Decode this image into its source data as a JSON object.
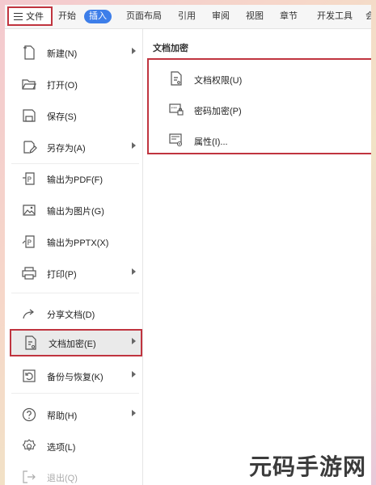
{
  "tabbar": {
    "file_label": "文件",
    "tabs": [
      "开始",
      "插入",
      "页面布局",
      "引用",
      "审阅",
      "视图",
      "章节",
      "开发工具",
      "会"
    ],
    "active_tab": "插入"
  },
  "menu": {
    "items": [
      {
        "label": "新建(N)",
        "icon": "new-document-icon",
        "has_submenu": true
      },
      {
        "label": "打开(O)",
        "icon": "folder-open-icon",
        "has_submenu": false
      },
      {
        "label": "保存(S)",
        "icon": "save-icon",
        "has_submenu": false
      },
      {
        "label": "另存为(A)",
        "icon": "save-as-icon",
        "has_submenu": true
      },
      {
        "label": "输出为PDF(F)",
        "icon": "export-pdf-icon",
        "has_submenu": false
      },
      {
        "label": "输出为图片(G)",
        "icon": "export-image-icon",
        "has_submenu": false
      },
      {
        "label": "输出为PPTX(X)",
        "icon": "export-pptx-icon",
        "has_submenu": false
      },
      {
        "label": "打印(P)",
        "icon": "print-icon",
        "has_submenu": true
      },
      {
        "label": "分享文档(D)",
        "icon": "share-icon",
        "has_submenu": false
      },
      {
        "label": "文档加密(E)",
        "icon": "document-encrypt-icon",
        "has_submenu": true,
        "selected": true
      },
      {
        "label": "备份与恢复(K)",
        "icon": "backup-restore-icon",
        "has_submenu": true
      },
      {
        "label": "帮助(H)",
        "icon": "help-icon",
        "has_submenu": true
      },
      {
        "label": "选项(L)",
        "icon": "settings-icon",
        "has_submenu": false
      },
      {
        "label": "退出(Q)",
        "icon": "exit-icon",
        "has_submenu": false
      }
    ]
  },
  "submenu": {
    "title": "文档加密",
    "items": [
      {
        "label": "文档权限(U)",
        "icon": "document-permission-icon"
      },
      {
        "label": "密码加密(P)",
        "icon": "password-lock-icon"
      },
      {
        "label": "属性(I)...",
        "icon": "properties-icon"
      }
    ]
  },
  "watermark": "元码手游网",
  "colors": {
    "highlight_border": "#c0343f",
    "active_tab_bg": "#3d7ee9"
  }
}
